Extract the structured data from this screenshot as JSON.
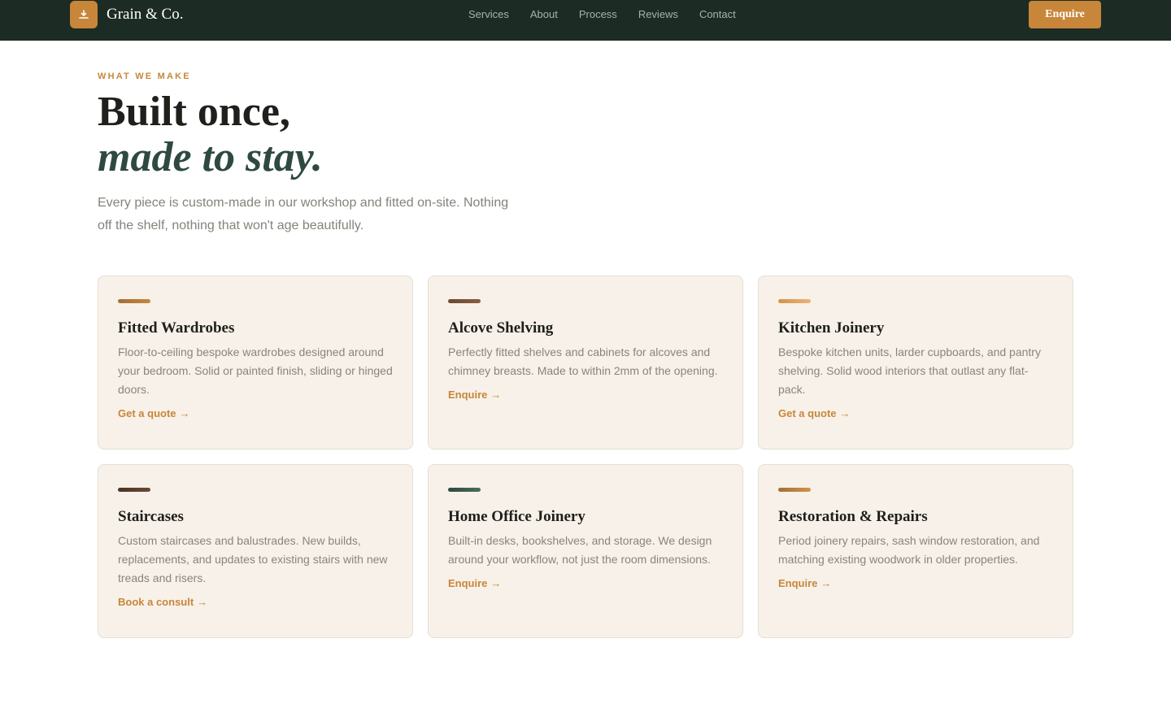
{
  "brand": {
    "name": "Grain & Co.",
    "logo_icon": "plane-tool-icon"
  },
  "nav": {
    "links": [
      "Services",
      "About",
      "Process",
      "Reviews",
      "Contact"
    ],
    "cta_label": "Enquire"
  },
  "hero": {
    "eyebrow": "WHAT WE MAKE",
    "headline_line1": "Built once,",
    "headline_line2": "made to stay.",
    "intro": "Every piece is custom-made in our workshop and fitted on-site. Nothing off the shelf, nothing that won't age beautifully."
  },
  "colors": {
    "nav_bg": "#1c2b24",
    "accent": "#c8863a",
    "green": "#2e4a3f",
    "card_bg": "#f7f1e9"
  },
  "services": [
    {
      "title": "Fitted Wardrobes",
      "description": "Floor-to-ceiling bespoke wardrobes designed around your bedroom. Solid or painted finish, sliding or hinged doors.",
      "link": "Get a quote",
      "arrow": "→",
      "accent_from": "#a0703a",
      "accent_to": "#c8863a"
    },
    {
      "title": "Alcove Shelving",
      "description": "Perfectly fitted shelves and cabinets for alcoves and chimney breasts. Made to within 2mm of the opening.",
      "link": "Enquire",
      "arrow": "→",
      "accent_from": "#6b4a32",
      "accent_to": "#8a5e3e"
    },
    {
      "title": "Kitchen Joinery",
      "description": "Bespoke kitchen units, larder cupboards, and pantry shelving. Solid wood interiors that outlast any flat-pack.",
      "link": "Get a quote",
      "arrow": "→",
      "accent_from": "#d4924a",
      "accent_to": "#e8b47a"
    },
    {
      "title": "Staircases",
      "description": "Custom staircases and balustrades. New builds, replacements, and updates to existing stairs with new treads and risers.",
      "link": "Book a consult",
      "arrow": "→",
      "accent_from": "#4a3426",
      "accent_to": "#6b4a32"
    },
    {
      "title": "Home Office Joinery",
      "description": "Built-in desks, bookshelves, and storage. We design around your workflow, not just the room dimensions.",
      "link": "Enquire",
      "arrow": "→",
      "accent_from": "#2e4a3f",
      "accent_to": "#4a6b5a"
    },
    {
      "title": "Restoration & Repairs",
      "description": "Period joinery repairs, sash window restoration, and matching existing woodwork in older properties.",
      "link": "Enquire",
      "arrow": "→",
      "accent_from": "#a0703a",
      "accent_to": "#d4924a"
    }
  ]
}
